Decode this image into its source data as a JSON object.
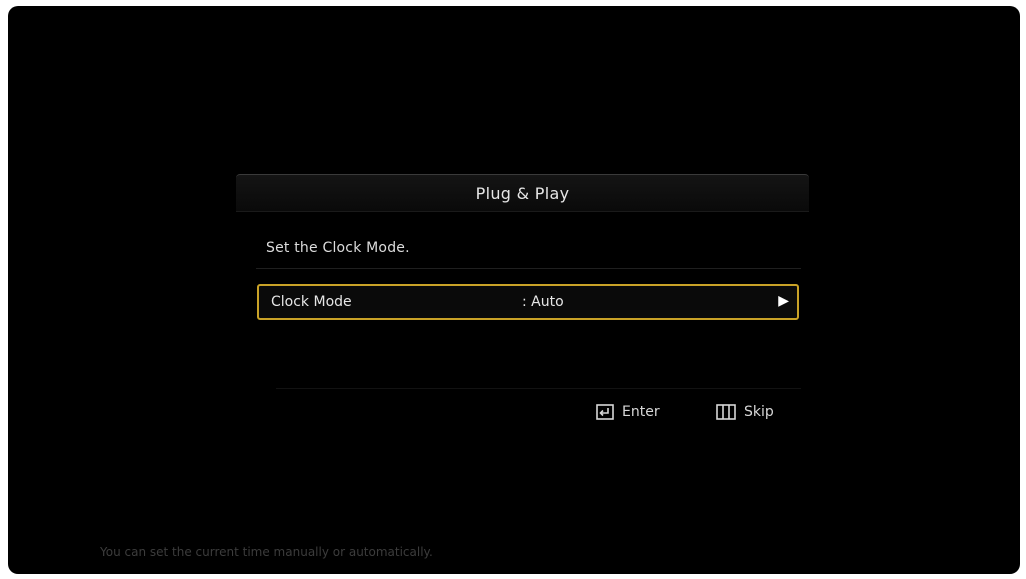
{
  "dialog": {
    "title": "Plug & Play",
    "prompt": "Set the Clock Mode.",
    "clock_mode": {
      "label": "Clock Mode",
      "value": ": Auto",
      "arrow_icon": "right-triangle-icon"
    }
  },
  "hints": {
    "enter": {
      "label": "Enter",
      "icon": "enter-icon"
    },
    "skip": {
      "label": "Skip",
      "icon": "menu-icon"
    }
  },
  "help_text": "You can set the current time manually or automatically.",
  "colors": {
    "background": "#000000",
    "highlight_border": "#c9a227",
    "text": "#e6e6e6",
    "help_text": "#3c3c3c"
  }
}
